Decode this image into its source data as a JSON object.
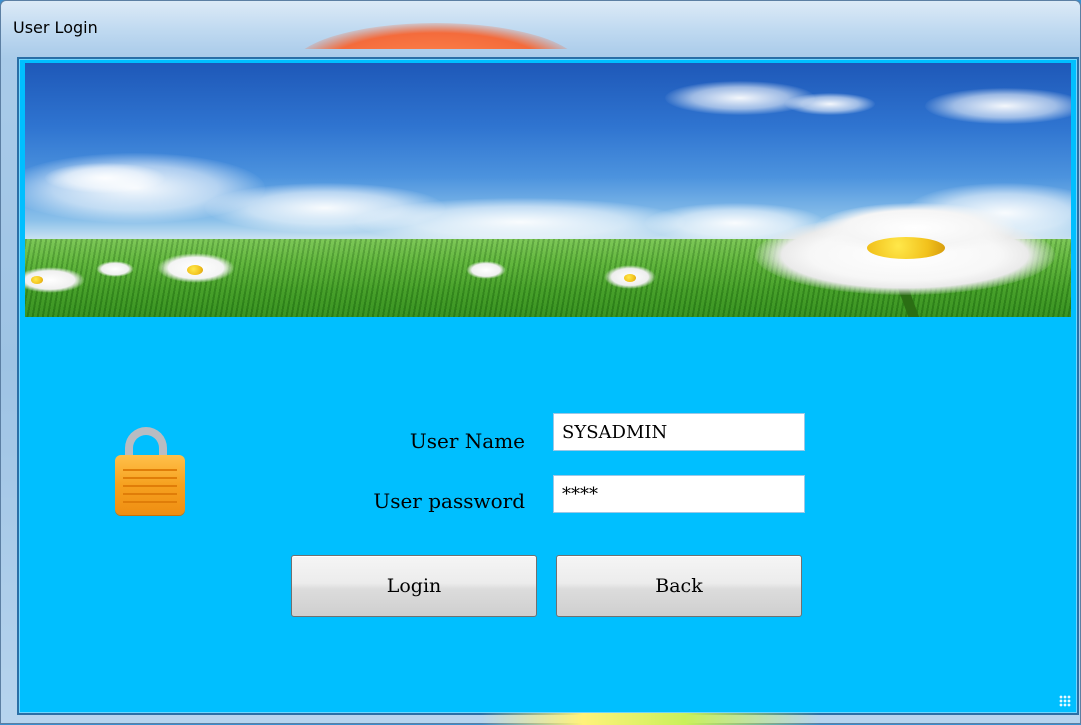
{
  "window": {
    "title": "User Login"
  },
  "form": {
    "username_label": "User Name",
    "password_label": "User password",
    "username_value": "SYSADMIN",
    "password_value": "****"
  },
  "buttons": {
    "login_label": "Login",
    "back_label": "Back"
  },
  "icons": {
    "lock": "lock-icon",
    "resize": "resize-grip-icon"
  },
  "colors": {
    "client_background": "#00bfff",
    "lock": "#f6a11f"
  }
}
